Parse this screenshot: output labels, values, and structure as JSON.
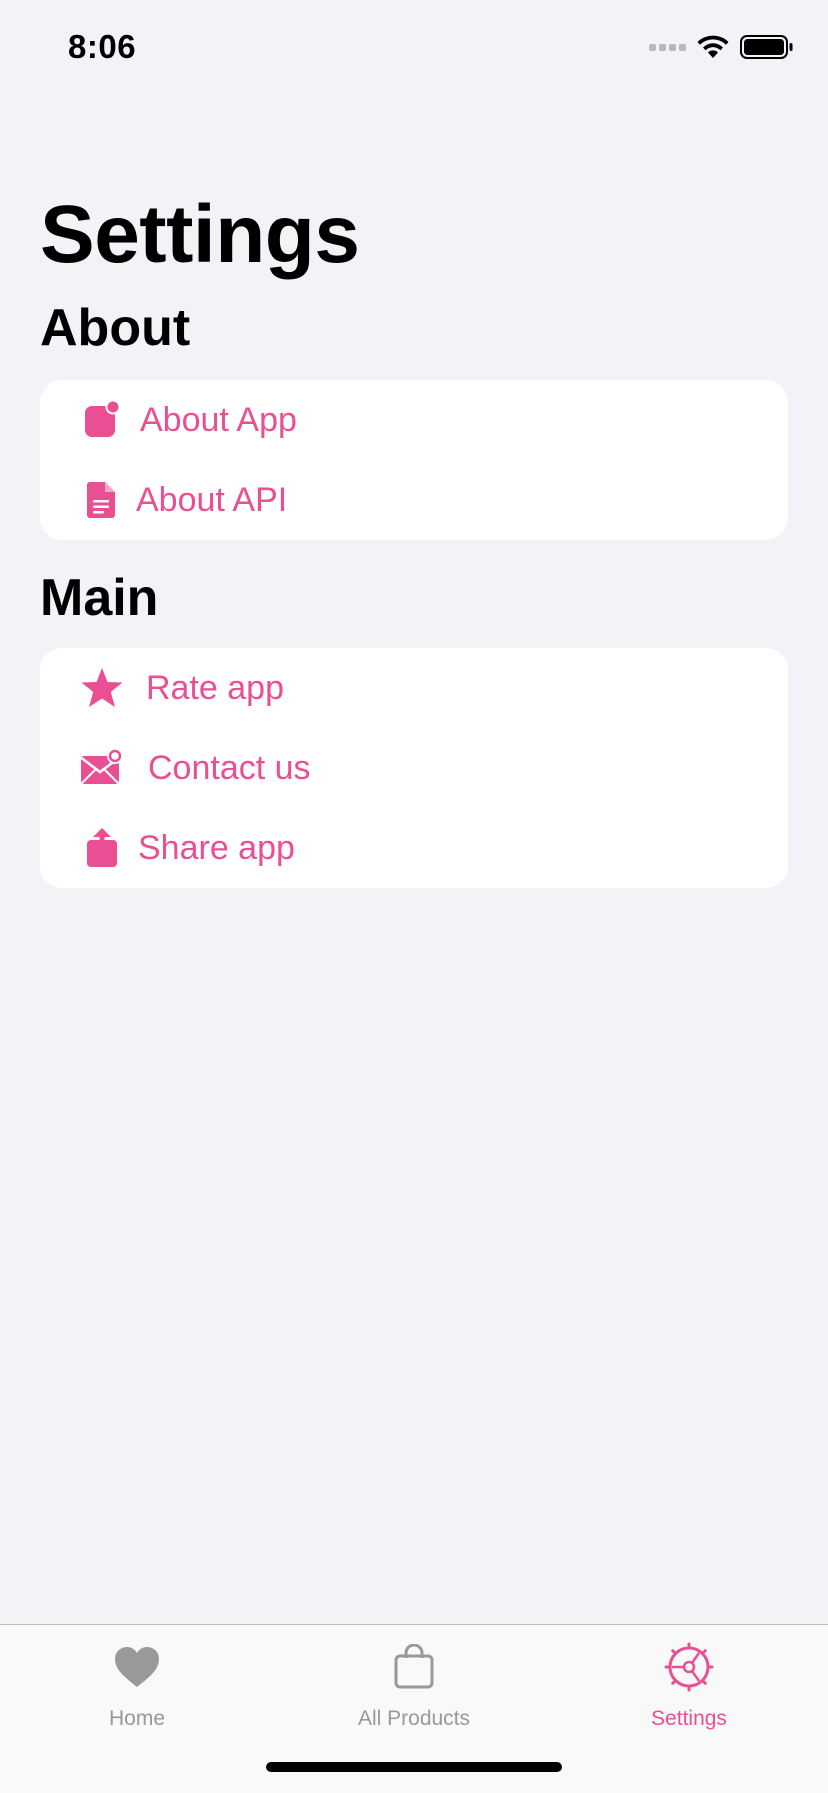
{
  "status_bar": {
    "time": "8:06"
  },
  "page_title": "Settings",
  "sections": {
    "about": {
      "title": "About",
      "items": [
        {
          "label": "About App",
          "icon": "app-badge-icon"
        },
        {
          "label": "About API",
          "icon": "document-icon"
        }
      ]
    },
    "main": {
      "title": "Main",
      "items": [
        {
          "label": "Rate app",
          "icon": "star-icon"
        },
        {
          "label": "Contact us",
          "icon": "envelope-badge-icon"
        },
        {
          "label": "Share app",
          "icon": "share-icon"
        }
      ]
    }
  },
  "tab_bar": {
    "items": [
      {
        "label": "Home",
        "icon": "heart-icon",
        "active": false
      },
      {
        "label": "All Products",
        "icon": "shopping-bag-icon",
        "active": false
      },
      {
        "label": "Settings",
        "icon": "steering-wheel-icon",
        "active": true
      }
    ]
  },
  "colors": {
    "accent": "#ea4f94",
    "background": "#f2f2f7",
    "card": "#ffffff",
    "inactive_tab": "#999999"
  }
}
